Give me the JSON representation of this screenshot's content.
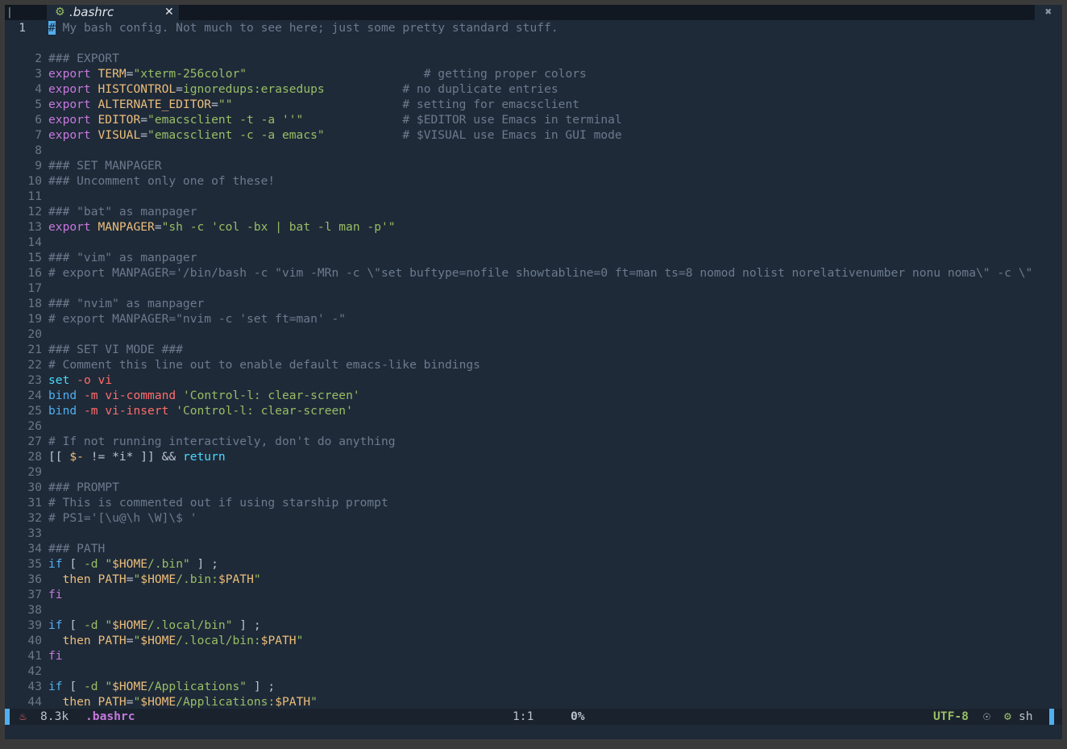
{
  "tab": {
    "filename": ".bashrc",
    "left_mark": "|",
    "close_glyph": "✕",
    "scroll_glyph": "✖",
    "icon": "gear-icon"
  },
  "lines": [
    {
      "n": "1",
      "cur": true,
      "parts": [
        [
          "cursor",
          "#"
        ],
        [
          "c-com",
          " My bash config. Not much to see here; just some pretty standard stuff."
        ]
      ]
    },
    {
      "n": "",
      "parts": []
    },
    {
      "n": "2",
      "parts": [
        [
          "c-com",
          "### EXPORT"
        ]
      ]
    },
    {
      "n": "3",
      "parts": [
        [
          "c-kw",
          "export"
        ],
        [
          "c-def",
          " "
        ],
        [
          "c-var",
          "TERM"
        ],
        [
          "c-def",
          "="
        ],
        [
          "c-str",
          "\"xterm-256color\""
        ],
        [
          "c-def",
          "                         "
        ],
        [
          "c-com",
          "# getting proper colors"
        ]
      ]
    },
    {
      "n": "4",
      "parts": [
        [
          "c-kw",
          "export"
        ],
        [
          "c-def",
          " "
        ],
        [
          "c-var",
          "HISTCONTROL"
        ],
        [
          "c-def",
          "="
        ],
        [
          "c-str",
          "ignoredups:erasedups"
        ],
        [
          "c-def",
          "           "
        ],
        [
          "c-com",
          "# no duplicate entries"
        ]
      ]
    },
    {
      "n": "5",
      "parts": [
        [
          "c-kw",
          "export"
        ],
        [
          "c-def",
          " "
        ],
        [
          "c-var",
          "ALTERNATE_EDITOR"
        ],
        [
          "c-def",
          "="
        ],
        [
          "c-str",
          "\"\""
        ],
        [
          "c-def",
          "                        "
        ],
        [
          "c-com",
          "# setting for emacsclient"
        ]
      ]
    },
    {
      "n": "6",
      "parts": [
        [
          "c-kw",
          "export"
        ],
        [
          "c-def",
          " "
        ],
        [
          "c-var",
          "EDITOR"
        ],
        [
          "c-def",
          "="
        ],
        [
          "c-str",
          "\"emacsclient -t -a ''\""
        ],
        [
          "c-def",
          "              "
        ],
        [
          "c-com",
          "# $EDITOR use Emacs in terminal"
        ]
      ]
    },
    {
      "n": "7",
      "parts": [
        [
          "c-kw",
          "export"
        ],
        [
          "c-def",
          " "
        ],
        [
          "c-var",
          "VISUAL"
        ],
        [
          "c-def",
          "="
        ],
        [
          "c-str",
          "\"emacsclient -c -a emacs\""
        ],
        [
          "c-def",
          "           "
        ],
        [
          "c-com",
          "# $VISUAL use Emacs in GUI mode"
        ]
      ]
    },
    {
      "n": "8",
      "parts": []
    },
    {
      "n": "9",
      "parts": [
        [
          "c-com",
          "### SET MANPAGER"
        ]
      ]
    },
    {
      "n": "10",
      "parts": [
        [
          "c-com",
          "### Uncomment only one of these!"
        ]
      ]
    },
    {
      "n": "11",
      "parts": []
    },
    {
      "n": "12",
      "parts": [
        [
          "c-com",
          "### \"bat\" as manpager"
        ]
      ]
    },
    {
      "n": "13",
      "parts": [
        [
          "c-kw",
          "export"
        ],
        [
          "c-def",
          " "
        ],
        [
          "c-var",
          "MANPAGER"
        ],
        [
          "c-def",
          "="
        ],
        [
          "c-str",
          "\"sh -c 'col -bx | bat -l man -p'\""
        ]
      ]
    },
    {
      "n": "14",
      "parts": []
    },
    {
      "n": "15",
      "parts": [
        [
          "c-com",
          "### \"vim\" as manpager"
        ]
      ]
    },
    {
      "n": "16",
      "parts": [
        [
          "c-com",
          "# export MANPAGER='/bin/bash -c \"vim -MRn -c \\\"set buftype=nofile showtabline=0 ft=man ts=8 nomod nolist norelativenumber nonu noma\\\" -c \\\""
        ]
      ]
    },
    {
      "n": "17",
      "parts": []
    },
    {
      "n": "18",
      "parts": [
        [
          "c-com",
          "### \"nvim\" as manpager"
        ]
      ]
    },
    {
      "n": "19",
      "parts": [
        [
          "c-com",
          "# export MANPAGER=\"nvim -c 'set ft=man' -\""
        ]
      ]
    },
    {
      "n": "20",
      "parts": []
    },
    {
      "n": "21",
      "parts": [
        [
          "c-com",
          "### SET VI MODE ###"
        ]
      ]
    },
    {
      "n": "22",
      "parts": [
        [
          "c-com",
          "# Comment this line out to enable default emacs-like bindings"
        ]
      ]
    },
    {
      "n": "23",
      "parts": [
        [
          "c-cyan",
          "set"
        ],
        [
          "c-def",
          " "
        ],
        [
          "c-opt",
          "-o"
        ],
        [
          "c-def",
          " "
        ],
        [
          "c-op",
          "vi"
        ]
      ]
    },
    {
      "n": "24",
      "parts": [
        [
          "c-blt",
          "bind"
        ],
        [
          "c-def",
          " "
        ],
        [
          "c-opt",
          "-m"
        ],
        [
          "c-def",
          " "
        ],
        [
          "c-op",
          "vi-command"
        ],
        [
          "c-def",
          " "
        ],
        [
          "c-str",
          "'Control-l: clear-screen'"
        ]
      ]
    },
    {
      "n": "25",
      "parts": [
        [
          "c-blt",
          "bind"
        ],
        [
          "c-def",
          " "
        ],
        [
          "c-opt",
          "-m"
        ],
        [
          "c-def",
          " "
        ],
        [
          "c-op",
          "vi-insert"
        ],
        [
          "c-def",
          " "
        ],
        [
          "c-str",
          "'Control-l: clear-screen'"
        ]
      ]
    },
    {
      "n": "26",
      "parts": []
    },
    {
      "n": "27",
      "parts": [
        [
          "c-com",
          "# If not running interactively, don't do anything"
        ]
      ]
    },
    {
      "n": "28",
      "parts": [
        [
          "c-def",
          "[[ "
        ],
        [
          "c-var",
          "$-"
        ],
        [
          "c-def",
          " != *i* ]] && "
        ],
        [
          "c-cyan",
          "return"
        ]
      ]
    },
    {
      "n": "29",
      "parts": []
    },
    {
      "n": "30",
      "parts": [
        [
          "c-com",
          "### PROMPT"
        ]
      ]
    },
    {
      "n": "31",
      "parts": [
        [
          "c-com",
          "# This is commented out if using starship prompt"
        ]
      ]
    },
    {
      "n": "32",
      "parts": [
        [
          "c-com",
          "# PS1='[\\u@\\h \\W]\\$ '"
        ]
      ]
    },
    {
      "n": "33",
      "parts": []
    },
    {
      "n": "34",
      "parts": [
        [
          "c-com",
          "### PATH"
        ]
      ]
    },
    {
      "n": "35",
      "parts": [
        [
          "c-blt",
          "if"
        ],
        [
          "c-def",
          " [ "
        ],
        [
          "c-str",
          "-d"
        ],
        [
          "c-def",
          " "
        ],
        [
          "c-str",
          "\""
        ],
        [
          "c-var",
          "$HOME"
        ],
        [
          "c-str",
          "/.bin\""
        ],
        [
          "c-def",
          " ] ;"
        ]
      ]
    },
    {
      "n": "36",
      "parts": [
        [
          "c-def",
          "  "
        ],
        [
          "c-var",
          "then"
        ],
        [
          "c-def",
          " "
        ],
        [
          "c-var",
          "PATH"
        ],
        [
          "c-def",
          "="
        ],
        [
          "c-str",
          "\""
        ],
        [
          "c-var",
          "$HOME"
        ],
        [
          "c-str",
          "/.bin:"
        ],
        [
          "c-var",
          "$PATH"
        ],
        [
          "c-str",
          "\""
        ]
      ]
    },
    {
      "n": "37",
      "parts": [
        [
          "c-kw",
          "fi"
        ]
      ]
    },
    {
      "n": "38",
      "parts": []
    },
    {
      "n": "39",
      "parts": [
        [
          "c-blt",
          "if"
        ],
        [
          "c-def",
          " [ "
        ],
        [
          "c-str",
          "-d"
        ],
        [
          "c-def",
          " "
        ],
        [
          "c-str",
          "\""
        ],
        [
          "c-var",
          "$HOME"
        ],
        [
          "c-str",
          "/.local/bin\""
        ],
        [
          "c-def",
          " ] ;"
        ]
      ]
    },
    {
      "n": "40",
      "parts": [
        [
          "c-def",
          "  "
        ],
        [
          "c-var",
          "then"
        ],
        [
          "c-def",
          " "
        ],
        [
          "c-var",
          "PATH"
        ],
        [
          "c-def",
          "="
        ],
        [
          "c-str",
          "\""
        ],
        [
          "c-var",
          "$HOME"
        ],
        [
          "c-str",
          "/.local/bin:"
        ],
        [
          "c-var",
          "$PATH"
        ],
        [
          "c-str",
          "\""
        ]
      ]
    },
    {
      "n": "41",
      "parts": [
        [
          "c-kw",
          "fi"
        ]
      ]
    },
    {
      "n": "42",
      "parts": []
    },
    {
      "n": "43",
      "parts": [
        [
          "c-blt",
          "if"
        ],
        [
          "c-def",
          " [ "
        ],
        [
          "c-str",
          "-d"
        ],
        [
          "c-def",
          " "
        ],
        [
          "c-str",
          "\""
        ],
        [
          "c-var",
          "$HOME"
        ],
        [
          "c-str",
          "/Applications\""
        ],
        [
          "c-def",
          " ] ;"
        ]
      ]
    },
    {
      "n": "44",
      "parts": [
        [
          "c-def",
          "  "
        ],
        [
          "c-var",
          "then"
        ],
        [
          "c-def",
          " "
        ],
        [
          "c-var",
          "PATH"
        ],
        [
          "c-def",
          "="
        ],
        [
          "c-str",
          "\""
        ],
        [
          "c-var",
          "$HOME"
        ],
        [
          "c-str",
          "/Applications:"
        ],
        [
          "c-var",
          "$PATH"
        ],
        [
          "c-str",
          "\""
        ]
      ]
    }
  ],
  "modeline": {
    "buffer_icon": "devil-icon",
    "size": "8.3k",
    "buffer_name": ".bashrc",
    "position": "1:1",
    "percent": "0%",
    "encoding": "UTF-8",
    "os_icon": "linux-icon",
    "mode_icon": "gear-icon",
    "mode": "sh"
  },
  "colors": {
    "background": "#1f2a38",
    "comment": "#6b7a8d",
    "keyword": "#c678dd",
    "variable": "#ecbe7b",
    "string": "#98be65",
    "builtin": "#51afef",
    "accent": "#51afef"
  }
}
